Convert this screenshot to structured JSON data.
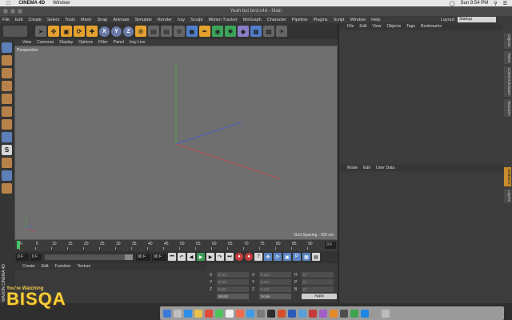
{
  "mac_menu": {
    "app": "CINEMA 4D",
    "items": [
      "Window"
    ],
    "clock": "Sun 9:54 PM"
  },
  "window": {
    "title": "Yeah but bird.c4d - Main"
  },
  "c4d_menu": [
    "File",
    "Edit",
    "Create",
    "Select",
    "Tools",
    "Mesh",
    "Snap",
    "Animate",
    "Simulate",
    "Render",
    "Iray",
    "Sculpt",
    "Motion Tracker",
    "MoGraph",
    "Character",
    "Pipeline",
    "Plugins",
    "Script",
    "Window",
    "Help"
  ],
  "layout": {
    "label": "Layout:",
    "value": "Startup"
  },
  "toolbar": {
    "axis_x": "X",
    "axis_y": "Y",
    "axis_z": "Z"
  },
  "viewport": {
    "menu": [
      "View",
      "Cameras",
      "Display",
      "Options",
      "Filter",
      "Panel",
      "Iray Live"
    ],
    "camera_label": "Perspective",
    "grid_spacing": "Grid Spacing : 100 cm"
  },
  "timeline": {
    "ticks": [
      "0",
      "5",
      "10",
      "15",
      "20",
      "25",
      "30",
      "35",
      "40",
      "45",
      "50",
      "55",
      "60",
      "65",
      "70",
      "75",
      "80",
      "85",
      "90"
    ],
    "current_frame": "0 F"
  },
  "transport": {
    "start_field": "0 F",
    "range_field": "0 F",
    "end_a": "90 F",
    "end_b": "90 F"
  },
  "material_manager": {
    "menu": [
      "Create",
      "Edit",
      "Function",
      "Texture"
    ]
  },
  "coordinates": {
    "rows": [
      {
        "a_axis": "X",
        "a_val": "0 cm",
        "b_axis": "X",
        "b_val": "0 cm",
        "c_axis": "H",
        "c_val": "0 °"
      },
      {
        "a_axis": "Y",
        "a_val": "0 cm",
        "b_axis": "Y",
        "b_val": "0 cm",
        "c_axis": "P",
        "c_val": "0 °"
      },
      {
        "a_axis": "Z",
        "a_val": "0 cm",
        "b_axis": "Z",
        "b_val": "0 cm",
        "c_axis": "B",
        "c_val": "0 °"
      }
    ],
    "mode_select": "World",
    "scale_select": "Scale",
    "apply_label": "Apply"
  },
  "object_manager": {
    "menu": [
      "File",
      "Edit",
      "View",
      "Objects",
      "Tags",
      "Bookmarks"
    ]
  },
  "attribute_manager": {
    "menu": [
      "Mode",
      "Edit",
      "User Data"
    ]
  },
  "side_tabs": [
    "Objects",
    "Takes",
    "Content Browser",
    "Structure",
    "Attributes",
    "Layers"
  ],
  "watermark": {
    "top": "You're Watching",
    "big": "BISQA"
  },
  "maxon_logo": "MAXON CINEMA 4D",
  "colors": {
    "accent_orange": "#e5a12e",
    "viewport_bg": "#6f6f6f",
    "axis_x": "#c64848",
    "axis_y": "#3fb24f",
    "axis_z": "#4a5bd0"
  }
}
